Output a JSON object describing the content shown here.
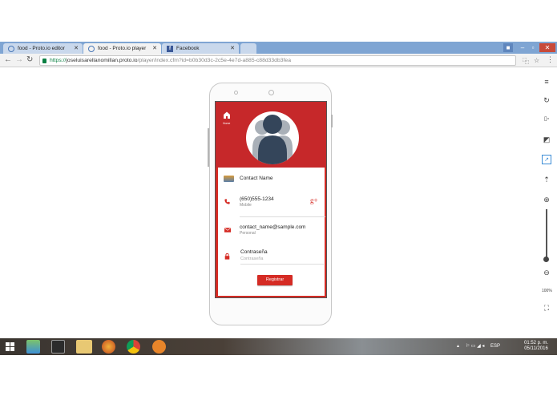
{
  "browser": {
    "tabs": [
      {
        "title": "food - Proto.io editor",
        "active": false
      },
      {
        "title": "food - Proto.io player",
        "active": true
      },
      {
        "title": "Facebook",
        "active": false
      }
    ],
    "url": {
      "scheme": "https://",
      "host": "joseluisarellanomillan.proto.io",
      "path": "/player/index.cfm?id=b0b30d3c-2c5e-4e7d-a885-c88d33db3fea"
    }
  },
  "app": {
    "home_label": "Home",
    "contact_name": "Contact Name",
    "phone": "(650)555-1234",
    "phone_type": "Mobile",
    "email": "contact_name@sample.com",
    "email_type": "Personal",
    "password_label": "Contraseña",
    "password_placeholder": "Contraseña",
    "register_button": "Registrar",
    "google_plus": "g+"
  },
  "toolbar": {
    "zoom_percent": "100%"
  },
  "taskbar": {
    "language": "ESP",
    "time": "01:52 p. m.",
    "date": "05/11/2016"
  },
  "colors": {
    "accent_red": "#d52b24",
    "tab_bar": "#7fa5d3",
    "avatar_dark": "#34455a"
  }
}
